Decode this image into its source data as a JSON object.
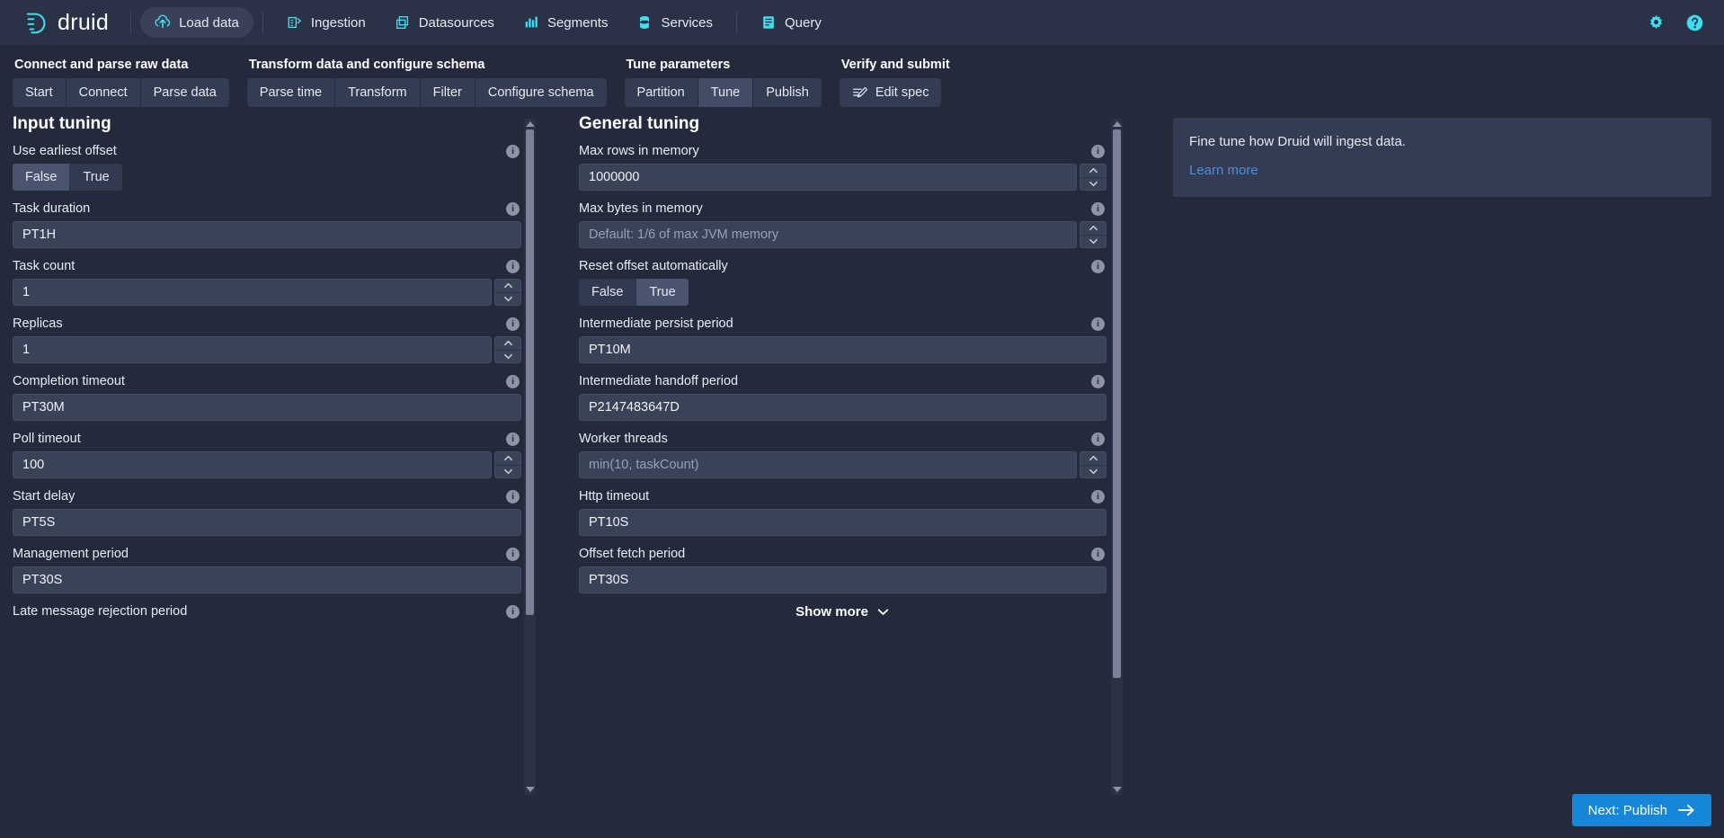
{
  "navbar": {
    "brand": "druid",
    "items": [
      {
        "label": "Load data",
        "icon": "upload-cloud-icon",
        "active": true
      },
      {
        "label": "Ingestion",
        "icon": "ingestion-icon",
        "active": false
      },
      {
        "label": "Datasources",
        "icon": "datasources-icon",
        "active": false
      },
      {
        "label": "Segments",
        "icon": "segments-icon",
        "active": false
      },
      {
        "label": "Services",
        "icon": "services-icon",
        "active": false
      },
      {
        "label": "Query",
        "icon": "query-icon",
        "active": false
      }
    ],
    "settings_icon": "gear-icon",
    "help_icon": "help-icon"
  },
  "steps": [
    {
      "title": "Connect and parse raw data",
      "buttons": [
        {
          "label": "Start",
          "active": false
        },
        {
          "label": "Connect",
          "active": false
        },
        {
          "label": "Parse data",
          "active": false
        }
      ]
    },
    {
      "title": "Transform data and configure schema",
      "buttons": [
        {
          "label": "Parse time",
          "active": false
        },
        {
          "label": "Transform",
          "active": false
        },
        {
          "label": "Filter",
          "active": false
        },
        {
          "label": "Configure schema",
          "active": false
        }
      ]
    },
    {
      "title": "Tune parameters",
      "buttons": [
        {
          "label": "Partition",
          "active": false
        },
        {
          "label": "Tune",
          "active": true
        },
        {
          "label": "Publish",
          "active": false
        }
      ]
    },
    {
      "title": "Verify and submit",
      "buttons": [
        {
          "label": "Edit spec",
          "active": false,
          "icon": "edit-spec-icon"
        }
      ]
    }
  ],
  "input_tuning": {
    "title": "Input tuning",
    "fields": [
      {
        "label": "Use earliest offset",
        "type": "toggle",
        "options": [
          "False",
          "True"
        ],
        "selected": "False"
      },
      {
        "label": "Task duration",
        "type": "text",
        "value": "PT1H"
      },
      {
        "label": "Task count",
        "type": "number",
        "value": "1"
      },
      {
        "label": "Replicas",
        "type": "number",
        "value": "1"
      },
      {
        "label": "Completion timeout",
        "type": "text",
        "value": "PT30M"
      },
      {
        "label": "Poll timeout",
        "type": "number",
        "value": "100"
      },
      {
        "label": "Start delay",
        "type": "text",
        "value": "PT5S"
      },
      {
        "label": "Management period",
        "type": "text",
        "value": "PT30S"
      },
      {
        "label": "Late message rejection period",
        "type": "label-only",
        "value": ""
      }
    ]
  },
  "general_tuning": {
    "title": "General tuning",
    "show_more_label": "Show more",
    "fields": [
      {
        "label": "Max rows in memory",
        "type": "number",
        "value": "1000000"
      },
      {
        "label": "Max bytes in memory",
        "type": "number",
        "value": "",
        "placeholder": "Default: 1/6 of max JVM memory"
      },
      {
        "label": "Reset offset automatically",
        "type": "toggle",
        "options": [
          "False",
          "True"
        ],
        "selected": "True"
      },
      {
        "label": "Intermediate persist period",
        "type": "text",
        "value": "PT10M"
      },
      {
        "label": "Intermediate handoff period",
        "type": "text",
        "value": "P2147483647D"
      },
      {
        "label": "Worker threads",
        "type": "number",
        "value": "",
        "placeholder": "min(10, taskCount)"
      },
      {
        "label": "Http timeout",
        "type": "text",
        "value": "PT10S"
      },
      {
        "label": "Offset fetch period",
        "type": "text",
        "value": "PT30S"
      }
    ]
  },
  "side_panel": {
    "text": "Fine tune how Druid will ingest data.",
    "link": "Learn more"
  },
  "footer": {
    "next_label": "Next: Publish",
    "next_icon": "arrow-right-icon"
  },
  "colors": {
    "accent": "#1586d8",
    "brand_cyan": "#3ae0f0",
    "link": "#4a8ed8",
    "background": "#24293b",
    "navbar": "#2b3147",
    "input": "#3a4258"
  }
}
